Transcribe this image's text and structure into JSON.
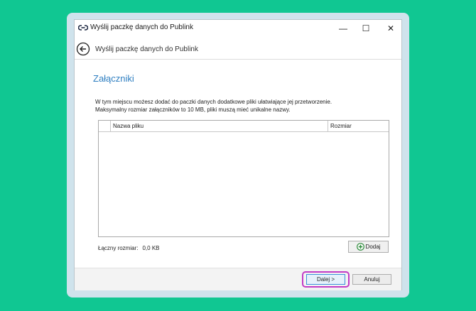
{
  "window": {
    "title": "Wyślij paczkę danych do Publink",
    "controls": {
      "minimize": "—",
      "maximize": "☐",
      "close": "✕"
    }
  },
  "nav": {
    "title": "Wyślij paczkę danych do Publink",
    "back_icon": "back-arrow-icon"
  },
  "content": {
    "section_title": "Załączniki",
    "description_line1": "W tym miejscu możesz dodać do paczki danych dodatkowe pliki ułatwiające jej przetworzenie.",
    "description_line2": "Maksymalny rozmiar załączników to 10 MB, pliki muszą mieć unikalne nazwy."
  },
  "table": {
    "columns": {
      "name": "Nazwa pliku",
      "size": "Rozmiar"
    },
    "rows": []
  },
  "summary": {
    "total_label": "Łączny rozmiar:",
    "total_value": "0,0 KB"
  },
  "buttons": {
    "add": "Dodaj",
    "next": "Dalej >",
    "cancel": "Anuluj"
  },
  "colors": {
    "background": "#10c792",
    "accent_title": "#2f7fc1",
    "highlight": "#c23bc6",
    "add_icon": "#2e8b3c"
  }
}
